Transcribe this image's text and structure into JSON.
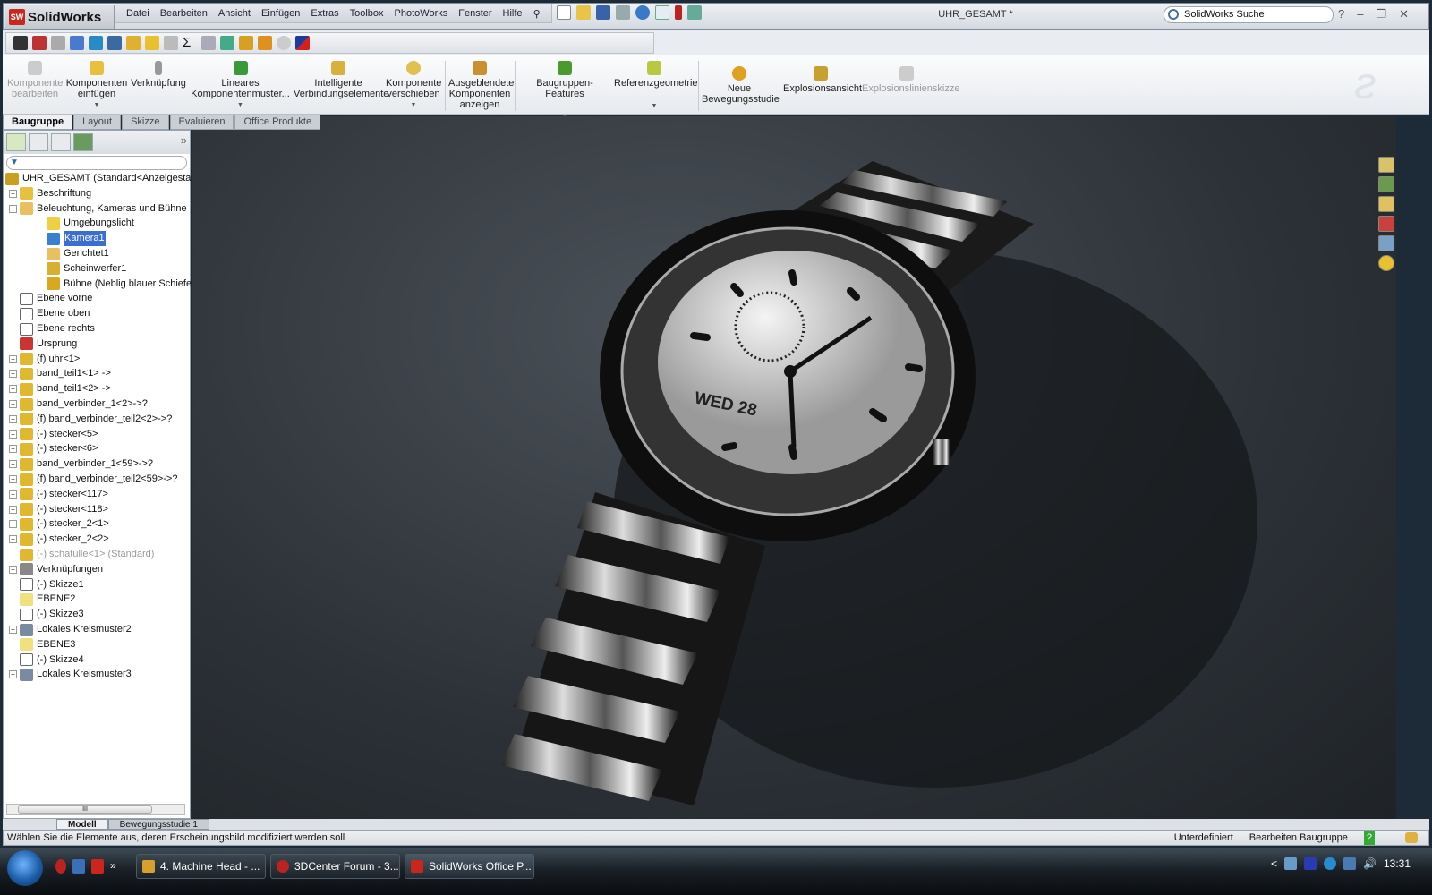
{
  "app": {
    "name": "SolidWorks",
    "logo_badge": "SW",
    "document_title": "UHR_GESAMT *"
  },
  "menu": [
    "Datei",
    "Bearbeiten",
    "Ansicht",
    "Einfügen",
    "Extras",
    "Toolbox",
    "PhotoWorks",
    "Fenster",
    "Hilfe"
  ],
  "search": {
    "placeholder": "SolidWorks Suche"
  },
  "command_manager": [
    {
      "label": "Komponente bearbeiten",
      "disabled": true
    },
    {
      "label": "Komponenten einfügen",
      "dropdown": true
    },
    {
      "label": "Verknüpfung"
    },
    {
      "label": "Lineares Komponentenmuster...",
      "dropdown": true
    },
    {
      "label": "Intelligente Verbindungselemente"
    },
    {
      "label": "Komponente verschieben",
      "dropdown": true
    },
    {
      "label": "Ausgeblendete Komponenten anzeigen"
    },
    {
      "label": "Baugruppen-Features",
      "dropdown": true
    },
    {
      "label": "Referenzgeometrie",
      "dropdown": true
    },
    {
      "label": "Neue Bewegungsstudie"
    },
    {
      "label": "Explosionsansicht"
    },
    {
      "label": "Explosionslinienskizze",
      "disabled": true
    }
  ],
  "tabs": [
    "Baugruppe",
    "Layout",
    "Skizze",
    "Evaluieren",
    "Office Produkte"
  ],
  "tree": [
    {
      "label": "UHR_GESAMT  (Standard<Anzeigestat",
      "level": 0,
      "exp": "",
      "icon": "assembly"
    },
    {
      "label": "Beschriftung",
      "level": 1,
      "exp": "+",
      "icon": "annotation"
    },
    {
      "label": "Beleuchtung, Kameras und Bühne",
      "level": 1,
      "exp": "-",
      "icon": "lights-folder"
    },
    {
      "label": "Umgebungslicht",
      "level": 2,
      "exp": "",
      "icon": "bulb"
    },
    {
      "label": "Kamera1",
      "level": 2,
      "exp": "",
      "icon": "camera",
      "selected": true
    },
    {
      "label": "Gerichtet1",
      "level": 2,
      "exp": "",
      "icon": "directional-light"
    },
    {
      "label": "Scheinwerfer1",
      "level": 2,
      "exp": "",
      "icon": "spotlight"
    },
    {
      "label": "Bühne (Neblig blauer Schiefer)",
      "level": 2,
      "exp": "",
      "icon": "scene"
    },
    {
      "label": "Ebene vorne",
      "level": 1,
      "exp": "",
      "icon": "plane"
    },
    {
      "label": "Ebene oben",
      "level": 1,
      "exp": "",
      "icon": "plane"
    },
    {
      "label": "Ebene rechts",
      "level": 1,
      "exp": "",
      "icon": "plane"
    },
    {
      "label": "Ursprung",
      "level": 1,
      "exp": "",
      "icon": "origin"
    },
    {
      "label": "(f) uhr<1>",
      "level": 1,
      "exp": "+",
      "icon": "part"
    },
    {
      "label": "band_teil1<1> ->",
      "level": 1,
      "exp": "+",
      "icon": "part"
    },
    {
      "label": "band_teil1<2> ->",
      "level": 1,
      "exp": "+",
      "icon": "part"
    },
    {
      "label": "band_verbinder_1<2>->?",
      "level": 1,
      "exp": "+",
      "icon": "part"
    },
    {
      "label": "(f) band_verbinder_teil2<2>->?",
      "level": 1,
      "exp": "+",
      "icon": "part"
    },
    {
      "label": "(-) stecker<5>",
      "level": 1,
      "exp": "+",
      "icon": "part"
    },
    {
      "label": "(-) stecker<6>",
      "level": 1,
      "exp": "+",
      "icon": "part"
    },
    {
      "label": "band_verbinder_1<59>->?",
      "level": 1,
      "exp": "+",
      "icon": "part"
    },
    {
      "label": "(f) band_verbinder_teil2<59>->?",
      "level": 1,
      "exp": "+",
      "icon": "part"
    },
    {
      "label": "(-) stecker<117>",
      "level": 1,
      "exp": "+",
      "icon": "part"
    },
    {
      "label": "(-) stecker<118>",
      "level": 1,
      "exp": "+",
      "icon": "part"
    },
    {
      "label": "(-) stecker_2<1>",
      "level": 1,
      "exp": "+",
      "icon": "part"
    },
    {
      "label": "(-) stecker_2<2>",
      "level": 1,
      "exp": "+",
      "icon": "part"
    },
    {
      "label": "(-) schatulle<1> (Standard)",
      "level": 1,
      "exp": "",
      "icon": "part",
      "grey": true
    },
    {
      "label": "Verknüpfungen",
      "level": 1,
      "exp": "+",
      "icon": "mates"
    },
    {
      "label": "(-) Skizze1",
      "level": 1,
      "exp": "",
      "icon": "sketch"
    },
    {
      "label": "EBENE2",
      "level": 1,
      "exp": "",
      "icon": "plane-yellow"
    },
    {
      "label": "(-) Skizze3",
      "level": 1,
      "exp": "",
      "icon": "sketch"
    },
    {
      "label": "Lokales Kreismuster2",
      "level": 1,
      "exp": "+",
      "icon": "pattern"
    },
    {
      "label": "EBENE3",
      "level": 1,
      "exp": "",
      "icon": "plane-yellow"
    },
    {
      "label": "(-) Skizze4",
      "level": 1,
      "exp": "",
      "icon": "sketch"
    },
    {
      "label": "Lokales Kreismuster3",
      "level": 1,
      "exp": "+",
      "icon": "pattern"
    }
  ],
  "scroll_thumb": "III",
  "watch": {
    "date_text": "WED 28"
  },
  "bottom_tabs": [
    "Modell",
    "Bewegungsstudie 1"
  ],
  "status": {
    "message": "Wählen Sie die Elemente aus, deren Erscheinungsbild modifiziert werden soll",
    "state": "Unterdefiniert",
    "mode": "Bearbeiten Baugruppe",
    "help": "?"
  },
  "taskbar": {
    "items": [
      "4. Machine Head - ...",
      "3DCenter Forum - 3...",
      "SolidWorks Office P..."
    ],
    "overflow": "»",
    "clock": "13:31",
    "tray_arrow": "<"
  },
  "colors": {
    "selection": "#3a6fcf",
    "brand_red": "#c8261e"
  }
}
